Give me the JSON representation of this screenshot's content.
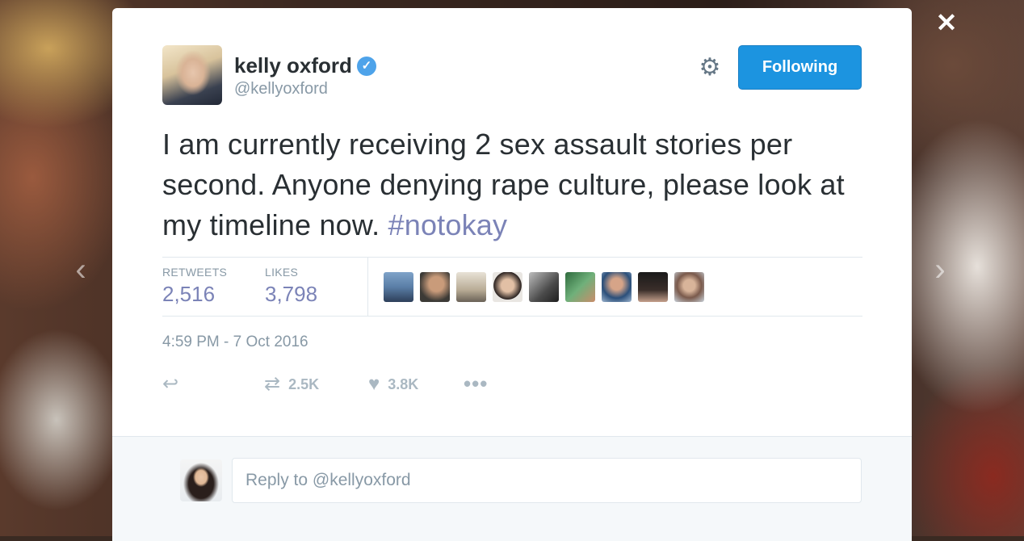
{
  "nav": {
    "close_icon": "close-icon",
    "prev_icon": "chevron-left-icon",
    "next_icon": "chevron-right-icon"
  },
  "tweet": {
    "author": {
      "name": "kelly oxford",
      "handle": "@kellyoxford",
      "verified": true
    },
    "follow_label": "Following",
    "text_main": "I am currently receiving 2 sex assault stories per second. Anyone denying rape culture, please look at my timeline now. ",
    "hashtag": "#notokay",
    "stats": {
      "retweets_label": "RETWEETS",
      "retweets_value": "2,516",
      "likes_label": "LIKES",
      "likes_value": "3,798"
    },
    "liker_avatar_count": 9,
    "timestamp": "4:59 PM - 7 Oct 2016",
    "actions": {
      "retweet_count": "2.5K",
      "like_count": "3.8K"
    }
  },
  "reply": {
    "placeholder": "Reply to @kellyoxford"
  },
  "colors": {
    "accent": "#1c94e0",
    "link": "#7b83b7",
    "verified": "#4ea3ea"
  }
}
